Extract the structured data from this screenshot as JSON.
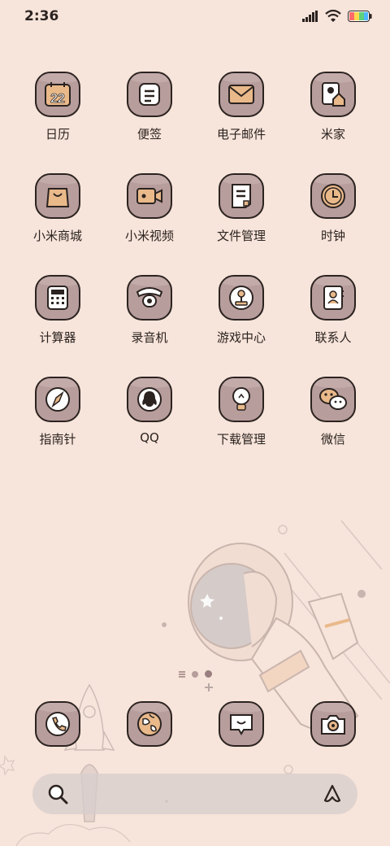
{
  "status": {
    "time": "2:36",
    "icons": [
      "signal-icon",
      "wifi-icon",
      "battery-icon"
    ],
    "battery_colors": [
      "#ff6b6b",
      "#ffd84d",
      "#5ed17a",
      "#4fb7ff"
    ]
  },
  "apps": [
    {
      "label": "日历",
      "icon": "calendar-icon",
      "day": "22"
    },
    {
      "label": "便签",
      "icon": "notes-icon"
    },
    {
      "label": "电子邮件",
      "icon": "mail-icon"
    },
    {
      "label": "米家",
      "icon": "mijia-icon"
    },
    {
      "label": "小米商城",
      "icon": "shopping-bag-icon"
    },
    {
      "label": "小米视频",
      "icon": "video-icon"
    },
    {
      "label": "文件管理",
      "icon": "file-icon"
    },
    {
      "label": "时钟",
      "icon": "clock-icon"
    },
    {
      "label": "计算器",
      "icon": "calculator-icon"
    },
    {
      "label": "录音机",
      "icon": "recorder-icon"
    },
    {
      "label": "游戏中心",
      "icon": "joystick-icon"
    },
    {
      "label": "联系人",
      "icon": "contacts-icon"
    },
    {
      "label": "指南针",
      "icon": "compass-icon"
    },
    {
      "label": "QQ",
      "icon": "qq-penguin-icon"
    },
    {
      "label": "下载管理",
      "icon": "lightbulb-icon"
    },
    {
      "label": "微信",
      "icon": "wechat-icon"
    }
  ],
  "dock": [
    {
      "name": "phone",
      "icon": "phone-icon"
    },
    {
      "name": "browser",
      "icon": "globe-icon"
    },
    {
      "name": "messages",
      "icon": "message-icon"
    },
    {
      "name": "camera",
      "icon": "camera-icon"
    }
  ],
  "search": {
    "icon": "search-icon",
    "assistant_icon": "assistant-icon"
  },
  "colors": {
    "background": "#f7e4da",
    "tile": "#b79d9c",
    "accent": "#e9b98a",
    "outline": "#2b2320"
  }
}
